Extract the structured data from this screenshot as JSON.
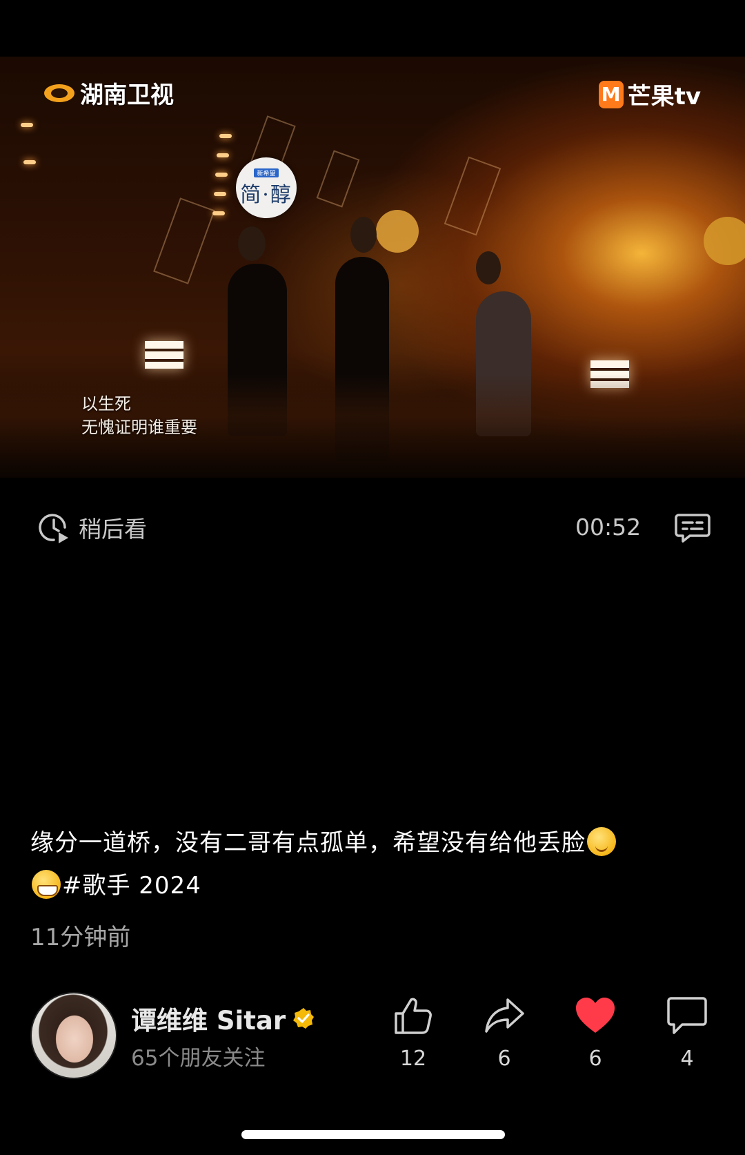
{
  "video": {
    "channel_logo": "湖南卫视",
    "platform_logo": "芒果tv",
    "platform_mark": "M",
    "sponsor_small": "新希望",
    "sponsor_big": "简·醇",
    "lyrics_line1": "以生死",
    "lyrics_line2": "无愧证明谁重要"
  },
  "toolbar": {
    "watch_later_label": "稍后看",
    "watch_later_icon": "clock-play-icon",
    "duration": "00:52",
    "danmaku_icon": "danmaku-icon"
  },
  "post": {
    "caption_part1": "缘分一道桥，没有二哥有点孤单，希望没有给他丢脸",
    "caption_hashtag": "#歌手 2024",
    "emoji_shy": "shy-face-emoji",
    "emoji_grin": "grin-emoji",
    "timestamp": "11分钟前"
  },
  "author": {
    "name": "谭维维 Sitar",
    "followers": "65个朋友关注",
    "verified_color": "#f5b90a"
  },
  "actions": {
    "like_count": "12",
    "share_count": "6",
    "heart_count": "6",
    "comment_count": "4",
    "heart_color": "#ff3b4a"
  }
}
